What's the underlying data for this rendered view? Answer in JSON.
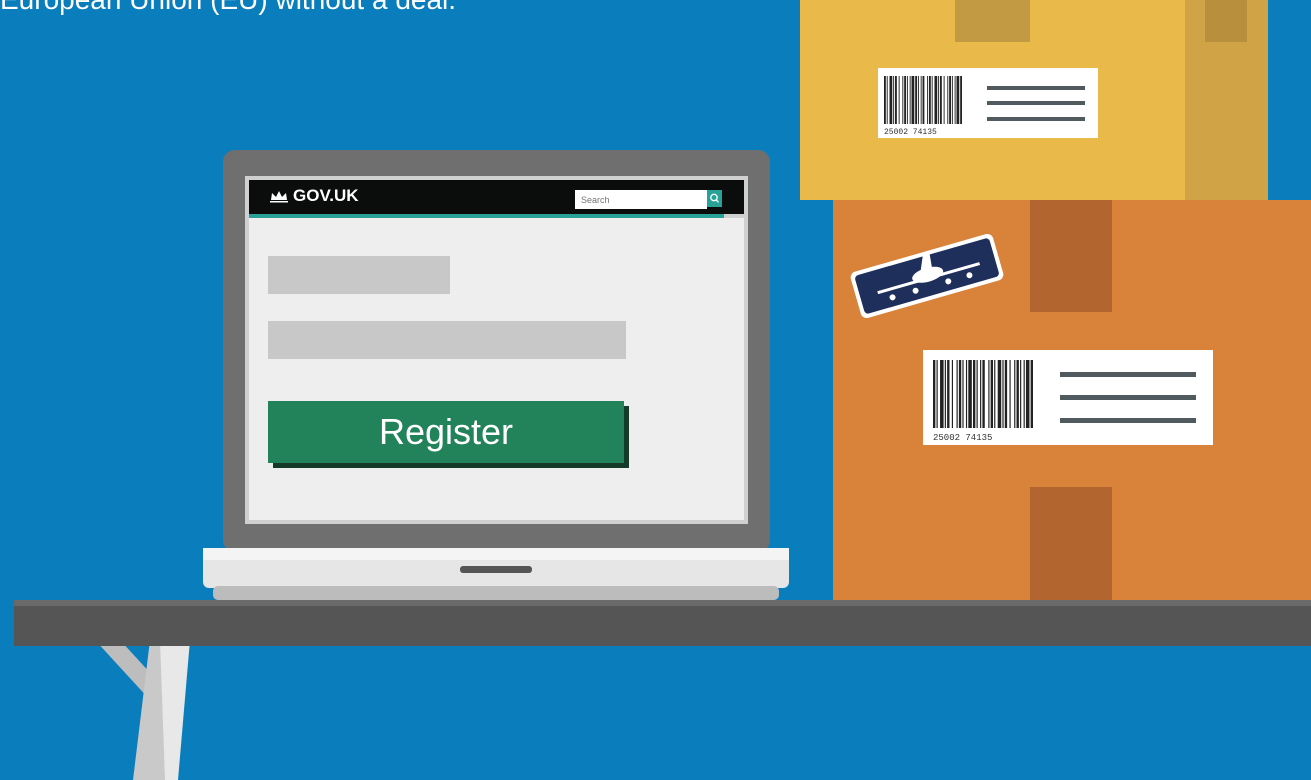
{
  "caption": "European Union (EU) without a deal.",
  "govuk": {
    "logo_text": "GOV.UK",
    "search_placeholder": "Search"
  },
  "form": {
    "register_label": "Register"
  },
  "barcode_numbers": [
    "25002 74135",
    "25002 74135"
  ],
  "colors": {
    "background": "#0a7dbc",
    "box_yellow": "#e9b94a",
    "box_orange": "#d8823a",
    "register_green": "#22835a",
    "govuk_black": "#0b0c0c",
    "accent_teal": "#28a197"
  },
  "icons": [
    "crown-icon",
    "search-icon",
    "airplane-icon",
    "barcode-icon"
  ]
}
